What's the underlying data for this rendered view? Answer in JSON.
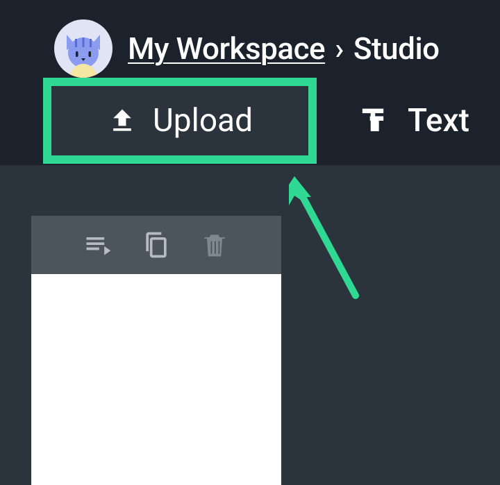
{
  "breadcrumb": {
    "workspace_label": "My Workspace",
    "separator": "›",
    "current": "Studio"
  },
  "tabs": {
    "upload_label": "Upload",
    "text_label": "Text"
  }
}
